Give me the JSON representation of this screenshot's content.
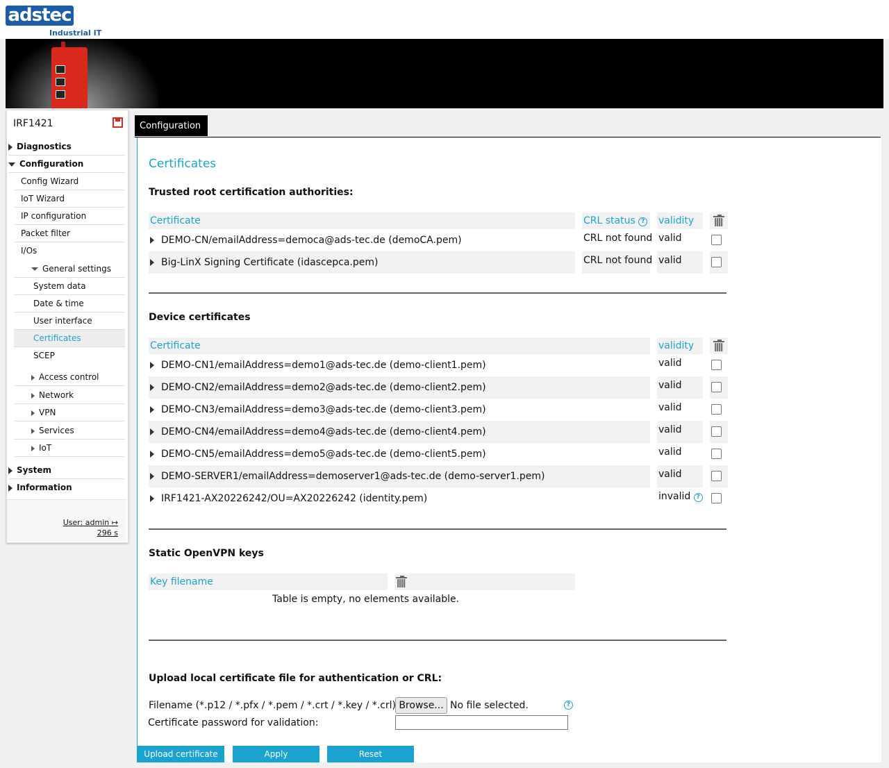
{
  "brand": {
    "logo_text": "adstec",
    "subtitle": "Industrial IT"
  },
  "sidebar": {
    "device_name": "IRF1421",
    "items": [
      {
        "label": "Diagnostics"
      },
      {
        "label": "Configuration"
      },
      {
        "label": "Config Wizard"
      },
      {
        "label": "IoT Wizard"
      },
      {
        "label": "IP configuration"
      },
      {
        "label": "Packet filter"
      },
      {
        "label": "I/Os"
      },
      {
        "label": "General settings"
      },
      {
        "label": "System data"
      },
      {
        "label": "Date & time"
      },
      {
        "label": "User interface"
      },
      {
        "label": "Certificates"
      },
      {
        "label": "SCEP"
      },
      {
        "label": "Access control"
      },
      {
        "label": "Network"
      },
      {
        "label": "VPN"
      },
      {
        "label": "Services"
      },
      {
        "label": "IoT"
      },
      {
        "label": "System"
      },
      {
        "label": "Information"
      }
    ],
    "user": "User: admin",
    "timer": "296 s"
  },
  "tabs": [
    {
      "label": "Configuration"
    }
  ],
  "page": {
    "title": "Certificates",
    "trusted": {
      "heading": "Trusted root certification authorities:",
      "col_certificate": "Certificate",
      "col_crl": "CRL status",
      "col_validity": "validity",
      "rows": [
        {
          "name": "DEMO-CN/emailAddress=democa@ads-tec.de (demoCA.pem)",
          "crl": "CRL not found",
          "validity": "valid"
        },
        {
          "name": "Big-LinX Signing Certificate (idascepca.pem)",
          "crl": "CRL not found",
          "validity": "valid"
        }
      ]
    },
    "device": {
      "heading": "Device certificates",
      "col_certificate": "Certificate",
      "col_validity": "validity",
      "rows": [
        {
          "name": "DEMO-CN1/emailAddress=demo1@ads-tec.de (demo-client1.pem)",
          "validity": "valid"
        },
        {
          "name": "DEMO-CN2/emailAddress=demo2@ads-tec.de (demo-client2.pem)",
          "validity": "valid"
        },
        {
          "name": "DEMO-CN3/emailAddress=demo3@ads-tec.de (demo-client3.pem)",
          "validity": "valid"
        },
        {
          "name": "DEMO-CN4/emailAddress=demo4@ads-tec.de (demo-client4.pem)",
          "validity": "valid"
        },
        {
          "name": "DEMO-CN5/emailAddress=demo5@ads-tec.de (demo-client5.pem)",
          "validity": "valid"
        },
        {
          "name": "DEMO-SERVER1/emailAddress=demoserver1@ads-tec.de (demo-server1.pem)",
          "validity": "valid"
        },
        {
          "name": "IRF1421-AX20226242/OU=AX20226242 (identity.pem)",
          "validity": "invalid"
        }
      ]
    },
    "openvpn": {
      "heading": "Static OpenVPN keys",
      "col_key": "Key filename",
      "empty": "Table is empty, no elements available."
    },
    "upload": {
      "heading": "Upload local certificate file for authentication or CRL:",
      "filename_label": "Filename (*.p12 / *.pfx / *.pem / *.crt / *.key / *.crl):",
      "browse": "Browse...",
      "no_file": "No file selected.",
      "password_label": "Certificate password for validation:"
    },
    "buttons": {
      "upload": "Upload certificate",
      "apply": "Apply",
      "reset": "Reset"
    }
  },
  "colors": {
    "accent": "#1aa3cf",
    "brand": "#1b5da6",
    "save": "#d8291c"
  }
}
